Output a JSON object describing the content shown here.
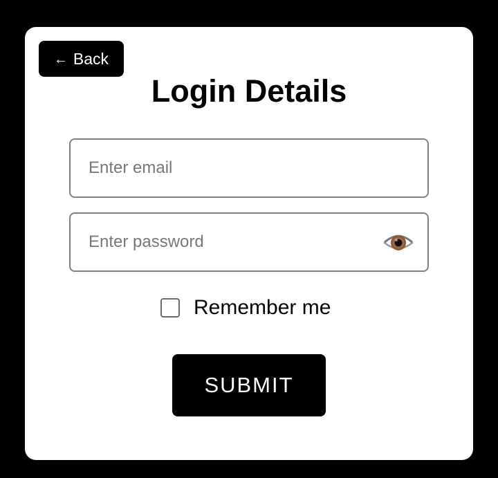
{
  "back_button": {
    "arrow": "←",
    "label": "Back"
  },
  "title": "Login Details",
  "email": {
    "placeholder": "Enter email",
    "value": ""
  },
  "password": {
    "placeholder": "Enter password",
    "value": "",
    "toggle_icon": "eye-icon"
  },
  "remember": {
    "label": "Remember me",
    "checked": false
  },
  "submit": {
    "label": "SUBMIT"
  },
  "colors": {
    "background": "#000000",
    "card": "#ffffff",
    "button": "#000000",
    "button_text": "#ffffff",
    "border": "#808080"
  }
}
